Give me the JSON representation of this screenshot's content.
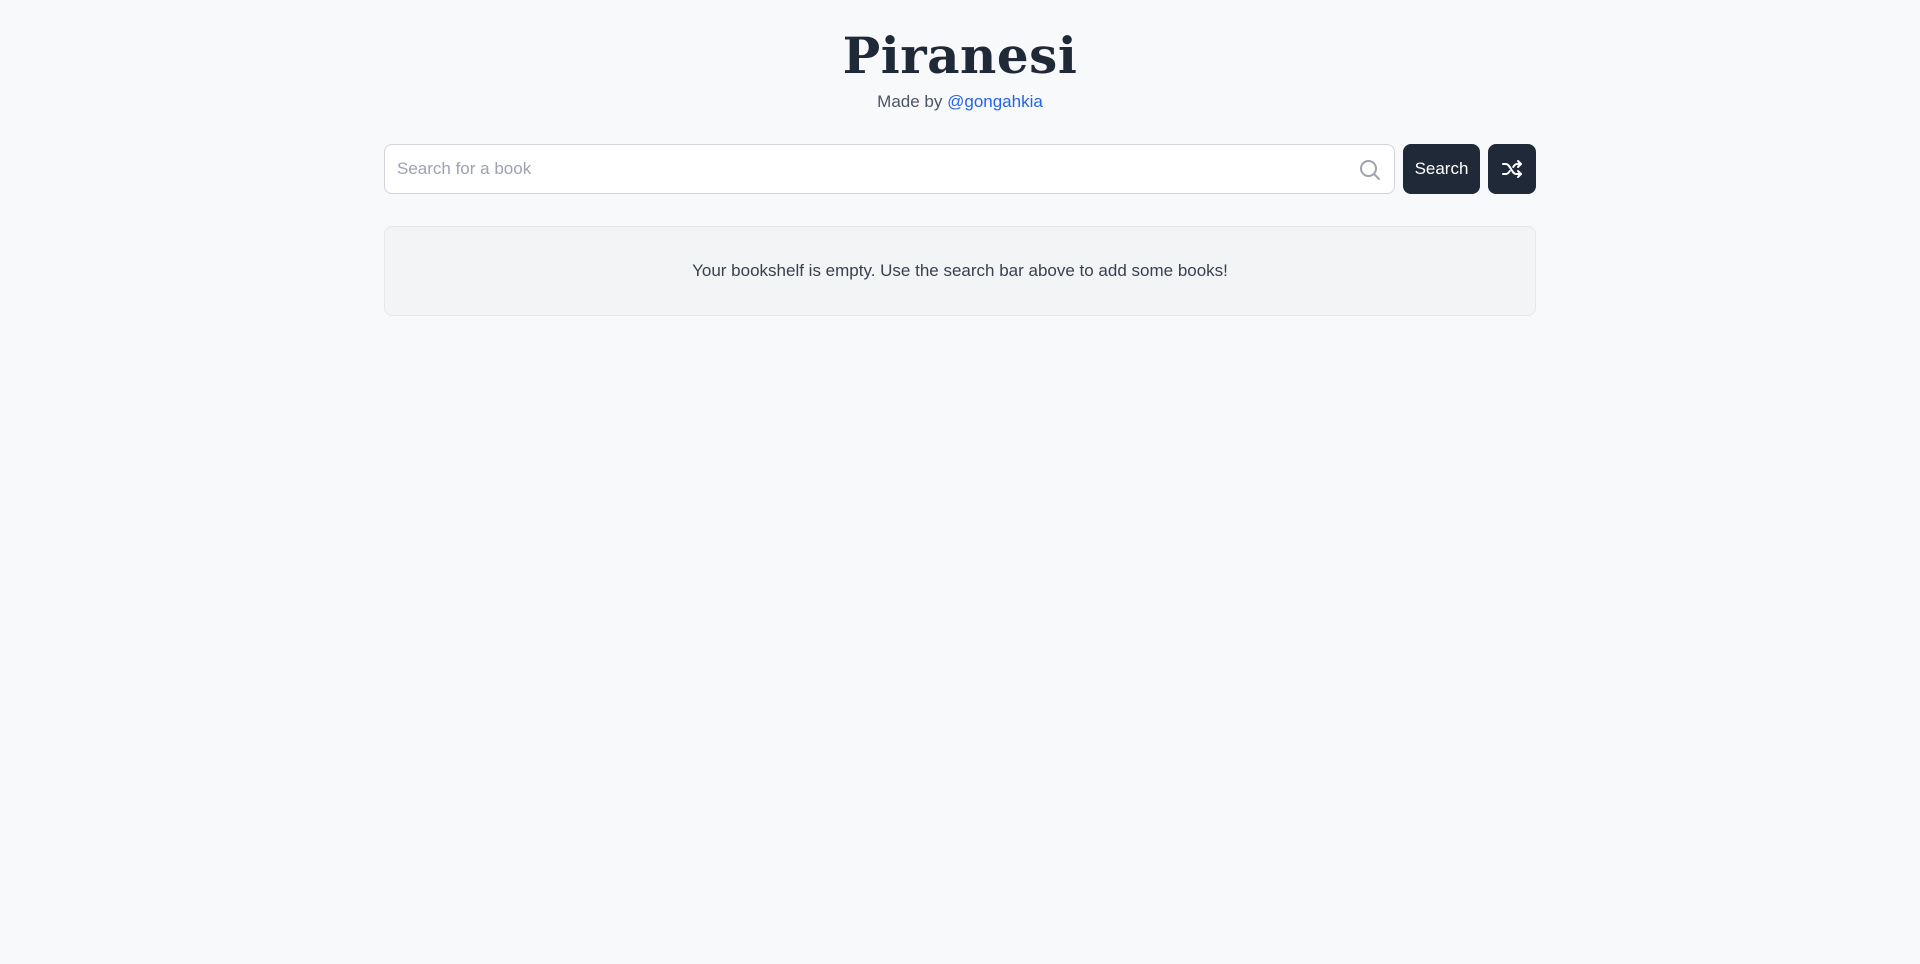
{
  "header": {
    "title": "Piranesi",
    "byline_prefix": "Made by",
    "author_link": "@gongahkia"
  },
  "search": {
    "placeholder": "Search for a book",
    "value": "",
    "icon": "search-icon",
    "button_label": "Search",
    "shuffle_icon": "shuffle-icon"
  },
  "bookshelf": {
    "empty_message": "Your bookshelf is empty. Use the search bar above to add some books!"
  },
  "colors": {
    "background": "#f8f9fb",
    "primary_button": "#1f2937",
    "link": "#2563eb",
    "empty_panel": "#f3f4f6"
  }
}
